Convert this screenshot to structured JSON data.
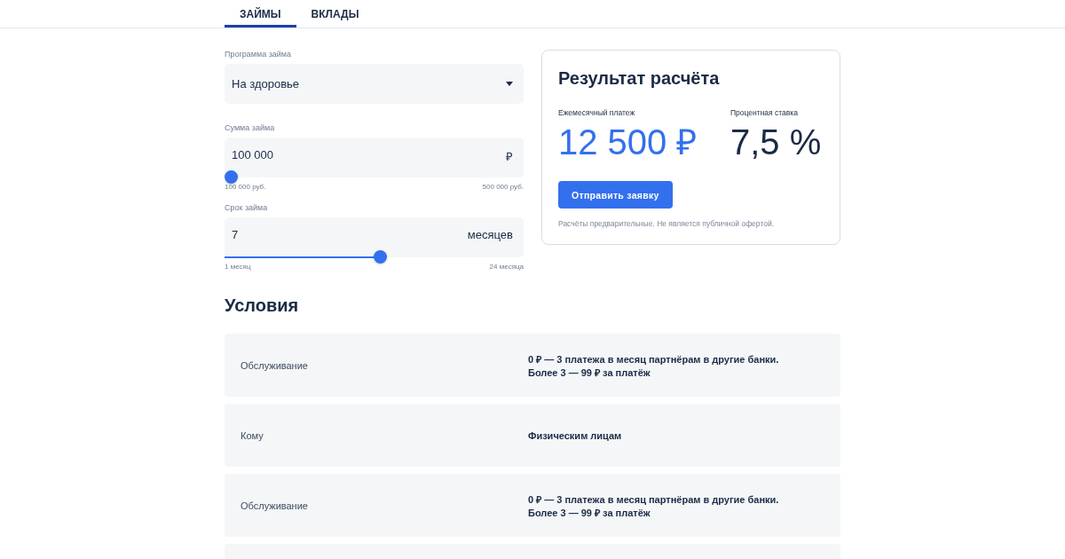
{
  "tabs": [
    {
      "label": "ЗАЙМЫ",
      "selected": true
    },
    {
      "label": "ВКЛАДЫ",
      "selected": false
    }
  ],
  "calculator": {
    "fields": [
      {
        "kind": "select",
        "label": "Программа займа",
        "value": "На здоровье"
      },
      {
        "kind": "slider",
        "label": "Сумма займа",
        "value": "100 000",
        "unit": "₽",
        "level": 0,
        "min_label": "100 000 руб.",
        "max_label": "500 000 руб."
      },
      {
        "kind": "slider",
        "label": "Срок займа",
        "value": "7",
        "unit": "месяцев",
        "level": 0.52,
        "min_label": "1 месяц",
        "max_label": "24 месяца"
      }
    ]
  },
  "result": {
    "title": "Результат расчёта",
    "metrics": [
      {
        "label": "Ежемесячный платеж",
        "value": "12 500 ₽",
        "accent": true
      },
      {
        "label": "Процентная ставка",
        "value": "7,5 %",
        "accent": false
      }
    ],
    "button": "Отправить заявку",
    "note": "Расчёты предварительные. Не является публичной офертой."
  },
  "conditions": {
    "title": "Условия",
    "rows": [
      {
        "label": "Обслуживание",
        "value": "0 ₽ — 3 платежа в месяц партнёрам в другие банки.\nБолее 3 — 99 ₽ за платёж"
      },
      {
        "label": "Кому",
        "value": "Физическим лицам"
      },
      {
        "label": "Обслуживание",
        "value": "0 ₽ — 3 платежа в месяц партнёрам в другие банки.\nБолее 3 — 99 ₽ за платёж"
      }
    ]
  }
}
